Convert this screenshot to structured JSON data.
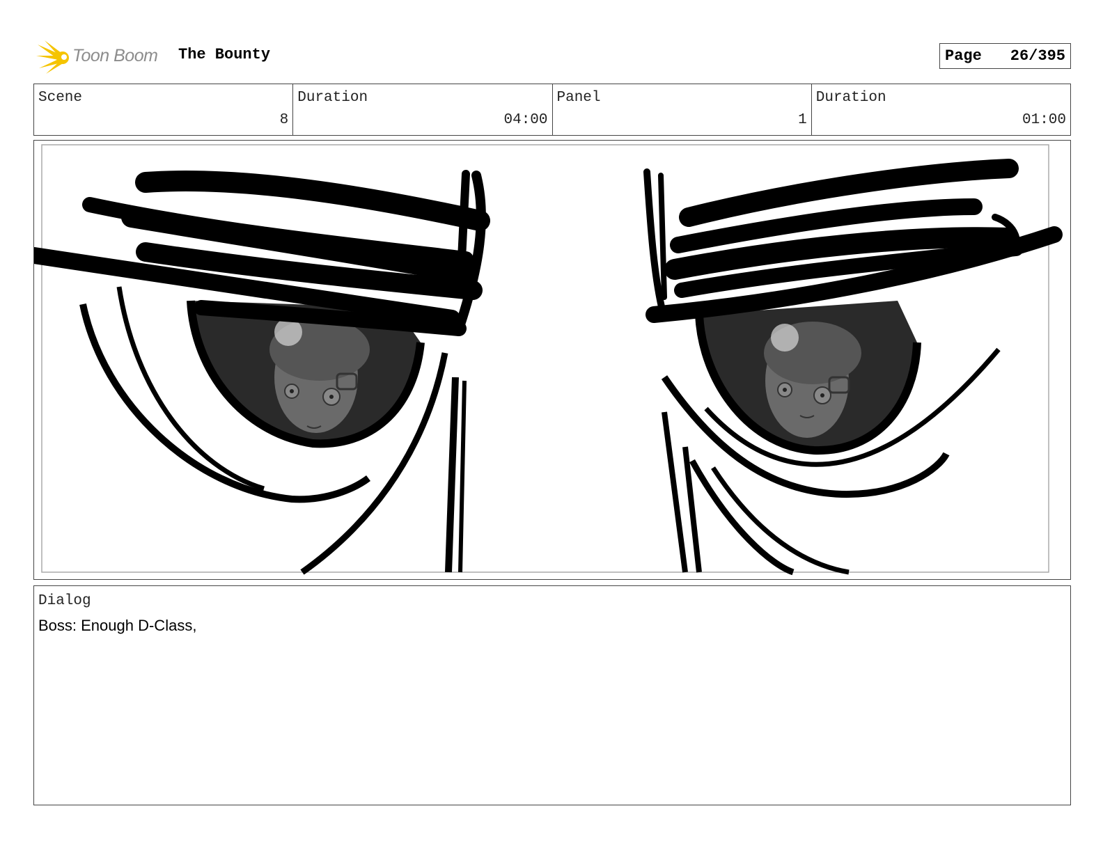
{
  "header": {
    "logo_text": "Toon Boom",
    "project_title": "The Bounty",
    "page_label": "Page",
    "page_value": "26/395"
  },
  "info": {
    "scene_label": "Scene",
    "scene_value": "8",
    "scene_duration_label": "Duration",
    "scene_duration_value": "04:00",
    "panel_label": "Panel",
    "panel_value": "1",
    "panel_duration_label": "Duration",
    "panel_duration_value": "01:00"
  },
  "dialog": {
    "label": "Dialog",
    "text": "Boss: Enough D-Class,"
  },
  "colors": {
    "logo_accent": "#f5c400",
    "logo_text": "#8c8c8c",
    "ink": "#000000",
    "iris": "#2a2a2a"
  }
}
